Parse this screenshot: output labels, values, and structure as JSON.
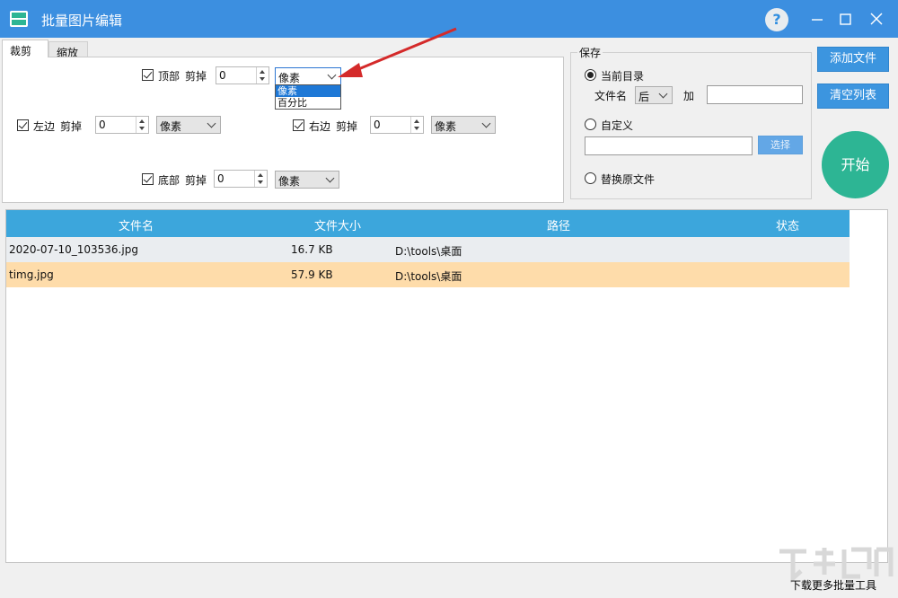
{
  "window": {
    "title": "批量图片编辑",
    "help_glyph": "?"
  },
  "tabs": [
    {
      "label": "裁剪",
      "active": true
    },
    {
      "label": "缩放",
      "active": false
    }
  ],
  "crop": {
    "top": {
      "label": "顶部",
      "action": "剪掉",
      "value": "0",
      "unit": "像素",
      "checked": true
    },
    "left": {
      "label": "左边",
      "action": "剪掉",
      "value": "0",
      "unit": "像素",
      "checked": true
    },
    "right": {
      "label": "右边",
      "action": "剪掉",
      "value": "0",
      "unit": "像素",
      "checked": true
    },
    "bottom": {
      "label": "底部",
      "action": "剪掉",
      "value": "0",
      "unit": "像素",
      "checked": true
    },
    "unit_options": [
      "像素",
      "百分比"
    ],
    "highlighted_option": "像素"
  },
  "save": {
    "legend": "保存",
    "current_dir_label": "当前目录",
    "filename_label": "文件名",
    "position_value": "后",
    "add_label": "加",
    "add_value": "",
    "custom_label": "自定义",
    "custom_path": "",
    "browse_label": "选择",
    "replace_label": "替换原文件",
    "selected": "current_dir"
  },
  "buttons": {
    "add_files": "添加文件",
    "clear_list": "清空列表",
    "start": "开始"
  },
  "table": {
    "headers": [
      "文件名",
      "文件大小",
      "路径",
      "状态"
    ],
    "rows": [
      {
        "name": "2020-07-10_103536.jpg",
        "size": "16.7 KB",
        "path": "D:\\tools\\桌面",
        "status": "",
        "bg": "#eaedf0"
      },
      {
        "name": "timg.jpg",
        "size": "57.9 KB",
        "path": "D:\\tools\\桌面",
        "status": "",
        "bg": "#fedcaa"
      }
    ]
  },
  "footer": {
    "link_text": "下载更多批量工具"
  },
  "colors": {
    "titlebar": "#3c8fe0",
    "table_header": "#3ca6dc",
    "start_button": "#2db594",
    "annotation_arrow": "#d42a2a"
  }
}
